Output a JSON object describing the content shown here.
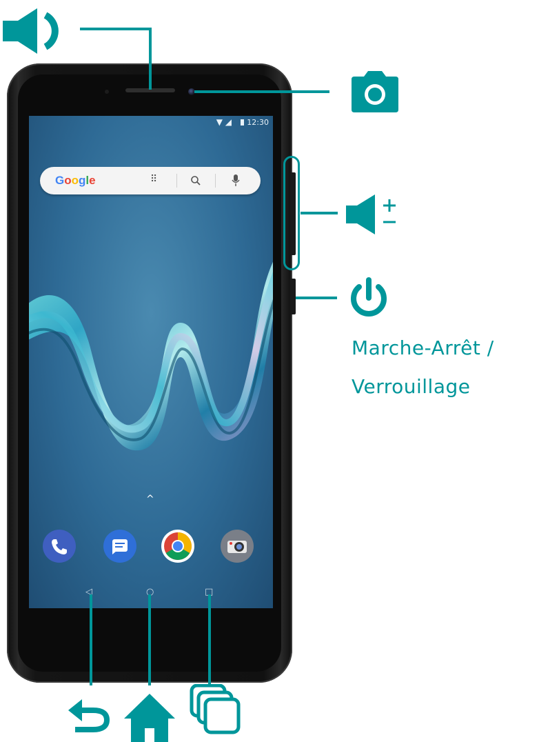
{
  "status_bar": {
    "time": "12:30"
  },
  "search_bar": {
    "brand": "Google"
  },
  "power_label": {
    "line1": "Marche-Arrêt /",
    "line2": "Verrouillage"
  },
  "colors": {
    "accent": "#00969a",
    "phone_body": "#111111",
    "screen": "#2e6a95"
  },
  "icons": {
    "earpiece": "speaker-icon",
    "camera": "camera-icon",
    "volume": "volume-plus-minus-icon",
    "power": "power-icon",
    "back": "back-arrow-icon",
    "home": "home-icon",
    "recents": "recent-apps-icon"
  },
  "dock_apps": [
    "phone-app-icon",
    "messages-app-icon",
    "chrome-app-icon",
    "camera-app-icon"
  ]
}
